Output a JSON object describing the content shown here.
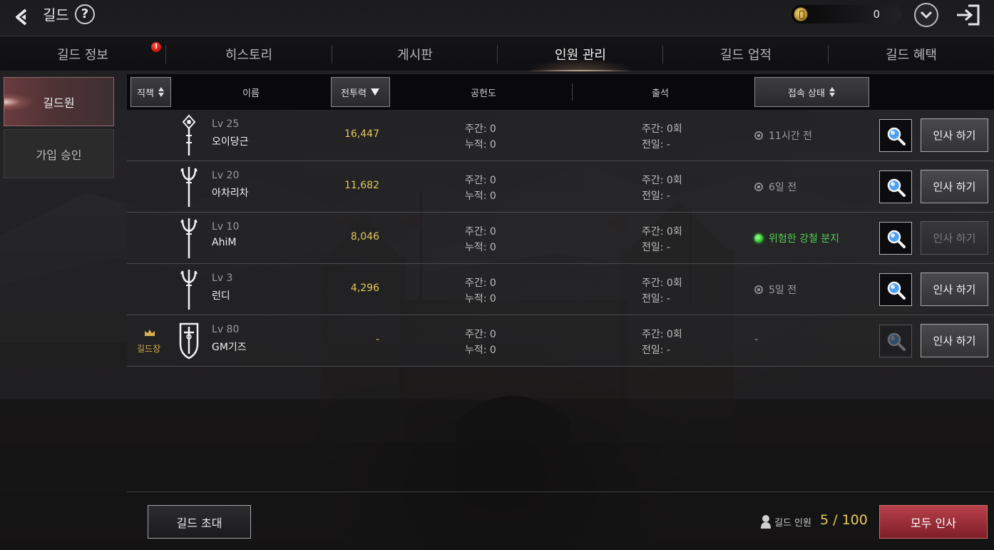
{
  "header": {
    "title": "길드",
    "help_icon": "question-mark-icon",
    "currency_value": "0",
    "currency_icon": "coin-icon"
  },
  "tabs": [
    {
      "label": "길드 정보",
      "alert": "!"
    },
    {
      "label": "히스토리"
    },
    {
      "label": "게시판"
    },
    {
      "label": "인원 관리",
      "active": true
    },
    {
      "label": "길드 업적"
    },
    {
      "label": "길드 혜택"
    }
  ],
  "sidebar": [
    {
      "label": "길드원",
      "active": true
    },
    {
      "label": "가입 승인"
    }
  ],
  "columns": {
    "rank": "직책",
    "name": "이름",
    "power": "전투력",
    "contribution": "공헌도",
    "attendance": "출석",
    "status": "접속 상태"
  },
  "members": [
    {
      "icon": "staff-class-icon",
      "level": "Lv 25",
      "name": "오이당근",
      "power": "16,447",
      "contrib_week": "주간: 0",
      "contrib_total": "누적: 0",
      "attend_week": "주간: 0회",
      "attend_prev": "전일: -",
      "status": "11시간 전",
      "online": false,
      "greet": "인사 하기",
      "greet_enabled": true
    },
    {
      "icon": "trident-class-icon",
      "level": "Lv 20",
      "name": "아차리차",
      "power": "11,682",
      "contrib_week": "주간: 0",
      "contrib_total": "누적: 0",
      "attend_week": "주간: 0회",
      "attend_prev": "전일: -",
      "status": "6일 전",
      "online": false,
      "greet": "인사 하기",
      "greet_enabled": true
    },
    {
      "icon": "trident-class-icon",
      "level": "Lv 10",
      "name": "AhiM",
      "power": "8,046",
      "contrib_week": "주간: 0",
      "contrib_total": "누적: 0",
      "attend_week": "주간: 0회",
      "attend_prev": "전일: -",
      "status": "위험한 강철 분지",
      "online": true,
      "greet": "인사 하기",
      "greet_enabled": false
    },
    {
      "icon": "trident-class-icon",
      "level": "Lv 3",
      "name": "런디",
      "power": "4,296",
      "contrib_week": "주간: 0",
      "contrib_total": "누적: 0",
      "attend_week": "주간: 0회",
      "attend_prev": "전일: -",
      "status": "5일 전",
      "online": false,
      "greet": "인사 하기",
      "greet_enabled": true
    },
    {
      "icon": "shield-sword-class-icon",
      "rank": "길드장",
      "level": "Lv 80",
      "name": "GM기즈",
      "power": "-",
      "contrib_week": "주간: 0",
      "contrib_total": "누적: 0",
      "attend_week": "주간: 0회",
      "attend_prev": "전일: -",
      "status": "-",
      "online": null,
      "greet": "인사 하기",
      "greet_enabled": true,
      "search_enabled": false
    }
  ],
  "footer": {
    "invite_label": "길드 초대",
    "member_label": "길드 인원",
    "member_count": "5 / 100",
    "greet_all_label": "모두 인사"
  }
}
